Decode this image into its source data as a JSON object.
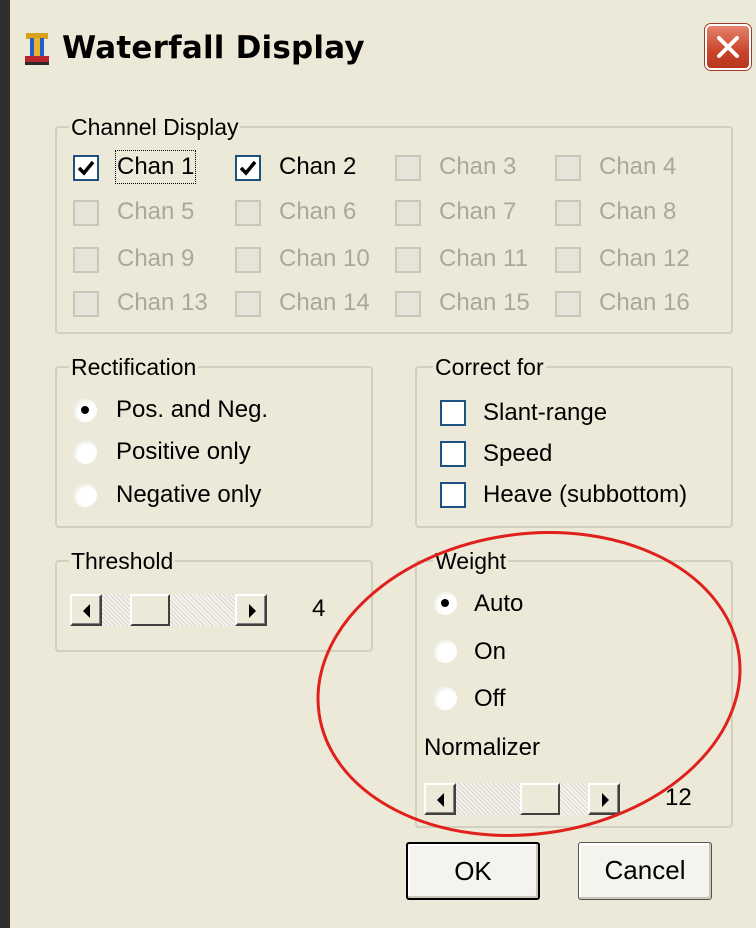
{
  "window": {
    "title": "Waterfall Display",
    "close_icon": "close-icon"
  },
  "channel_display": {
    "legend": "Channel Display",
    "channels": [
      {
        "label": "Chan 1",
        "checked": true,
        "enabled": true
      },
      {
        "label": "Chan 2",
        "checked": true,
        "enabled": true
      },
      {
        "label": "Chan 3",
        "checked": false,
        "enabled": false
      },
      {
        "label": "Chan 4",
        "checked": false,
        "enabled": false
      },
      {
        "label": "Chan 5",
        "checked": false,
        "enabled": false
      },
      {
        "label": "Chan 6",
        "checked": false,
        "enabled": false
      },
      {
        "label": "Chan 7",
        "checked": false,
        "enabled": false
      },
      {
        "label": "Chan 8",
        "checked": false,
        "enabled": false
      },
      {
        "label": "Chan 9",
        "checked": false,
        "enabled": false
      },
      {
        "label": "Chan 10",
        "checked": false,
        "enabled": false
      },
      {
        "label": "Chan 11",
        "checked": false,
        "enabled": false
      },
      {
        "label": "Chan 12",
        "checked": false,
        "enabled": false
      },
      {
        "label": "Chan 13",
        "checked": false,
        "enabled": false
      },
      {
        "label": "Chan 14",
        "checked": false,
        "enabled": false
      },
      {
        "label": "Chan 15",
        "checked": false,
        "enabled": false
      },
      {
        "label": "Chan 16",
        "checked": false,
        "enabled": false
      }
    ]
  },
  "rectification": {
    "legend": "Rectification",
    "options": [
      "Pos. and Neg.",
      "Positive only",
      "Negative only"
    ],
    "selected": 0
  },
  "correct_for": {
    "legend": "Correct for",
    "options": [
      {
        "label": "Slant-range",
        "checked": false
      },
      {
        "label": "Speed",
        "checked": false
      },
      {
        "label": "Heave (subbottom)",
        "checked": false
      }
    ]
  },
  "threshold": {
    "legend": "Threshold",
    "value": "4",
    "level": 0.3
  },
  "weight": {
    "legend": "Weight",
    "options": [
      "Auto",
      "On",
      "Off"
    ],
    "selected": 0,
    "normalizer_label": "Normalizer",
    "normalizer_value": "12",
    "normalizer_level": 0.7
  },
  "buttons": {
    "ok": "OK",
    "cancel": "Cancel"
  },
  "colors": {
    "dialog_bg": "#ece9d8",
    "highlight_ellipse": "#e0201c",
    "disabled_text": "#a9a89c"
  }
}
